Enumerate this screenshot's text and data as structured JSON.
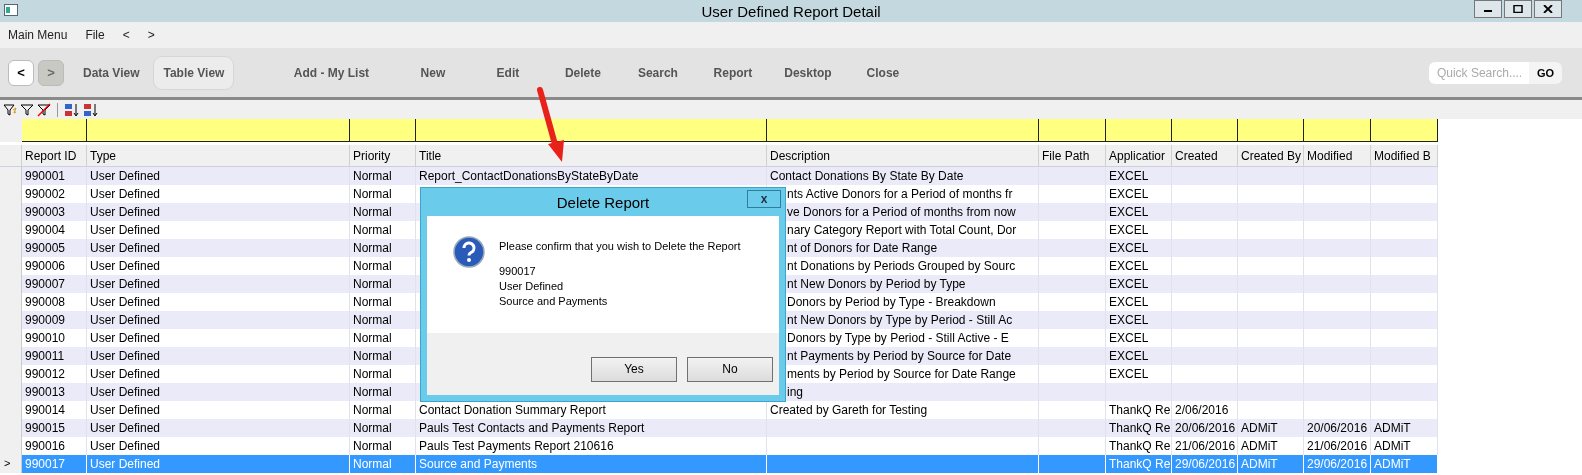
{
  "window": {
    "title": "User Defined Report Detail"
  },
  "menu": [
    "Main Menu",
    "File",
    "<",
    ">"
  ],
  "toolbar": {
    "nav": [
      {
        "label": "<",
        "disabled": false
      },
      {
        "label": ">",
        "disabled": true
      }
    ],
    "views": [
      {
        "label": "Data View",
        "selected": false
      },
      {
        "label": "Table View",
        "selected": true
      }
    ],
    "actions": [
      "Add - My List",
      "New",
      "Edit",
      "Delete",
      "Search",
      "Report",
      "Desktop",
      "Close"
    ],
    "search": {
      "placeholder": "Quick Search....",
      "button": "GO"
    }
  },
  "table": {
    "columns": [
      "Report ID",
      "Type",
      "Priority",
      "Title",
      "Description",
      "File Path",
      "Applicatior",
      "Created",
      "Created By",
      "Modified",
      "Modified B"
    ],
    "rows": [
      {
        "id": "990001",
        "type": "User Defined",
        "priority": "Normal",
        "title": "Report_ContactDonationsByStateByDate",
        "description": "Contact Donations By State By Date",
        "application": "EXCEL",
        "covered": false,
        "selected": false
      },
      {
        "id": "990002",
        "type": "User Defined",
        "priority": "Normal",
        "description": "nts Active Donors for a Period of months fr",
        "application": "EXCEL",
        "covered": true,
        "selected": false
      },
      {
        "id": "990003",
        "type": "User Defined",
        "priority": "Normal",
        "description": "ve Donors for a Period of months from now",
        "application": "EXCEL",
        "covered": true,
        "selected": false
      },
      {
        "id": "990004",
        "type": "User Defined",
        "priority": "Normal",
        "description": "nary Category Report with Total Count, Dor",
        "application": "EXCEL",
        "covered": true,
        "selected": false
      },
      {
        "id": "990005",
        "type": "User Defined",
        "priority": "Normal",
        "description": "nt of Donors for Date Range",
        "application": "EXCEL",
        "covered": true,
        "selected": false
      },
      {
        "id": "990006",
        "type": "User Defined",
        "priority": "Normal",
        "description": "nt Donations by Periods Grouped by Sourc",
        "application": "EXCEL",
        "covered": true,
        "selected": false
      },
      {
        "id": "990007",
        "type": "User Defined",
        "priority": "Normal",
        "description": "nt New Donors by Period by Type",
        "application": "EXCEL",
        "covered": true,
        "selected": false
      },
      {
        "id": "990008",
        "type": "User Defined",
        "priority": "Normal",
        "description": "Donors by Period by Type - Breakdown",
        "application": "EXCEL",
        "covered": true,
        "selected": false
      },
      {
        "id": "990009",
        "type": "User Defined",
        "priority": "Normal",
        "description": "nt New Donors by Type by Period - Still Ac",
        "application": "EXCEL",
        "covered": true,
        "selected": false
      },
      {
        "id": "990010",
        "type": "User Defined",
        "priority": "Normal",
        "description": "Donors by Type by Period - Still Active - E",
        "application": "EXCEL",
        "covered": true,
        "selected": false
      },
      {
        "id": "990011",
        "type": "User Defined",
        "priority": "Normal",
        "description": "nt Payments by Period by Source for Date",
        "application": "EXCEL",
        "covered": true,
        "selected": false
      },
      {
        "id": "990012",
        "type": "User Defined",
        "priority": "Normal",
        "description": "ments by Period by Source for Date Range",
        "application": "EXCEL",
        "covered": true,
        "selected": false
      },
      {
        "id": "990013",
        "type": "User Defined",
        "priority": "Normal",
        "description": "ing",
        "covered": true,
        "selected": false
      },
      {
        "id": "990014",
        "type": "User Defined",
        "priority": "Normal",
        "title": "Contact Donation Summary Report",
        "description": "Created by Gareth for Testing",
        "application": "ThankQ Re",
        "created": "2/06/2016",
        "covered": false,
        "selected": false
      },
      {
        "id": "990015",
        "type": "User Defined",
        "priority": "Normal",
        "title": "Pauls Test Contacts and Payments Report",
        "application": "ThankQ Re",
        "created": "20/06/2016",
        "created_by": "ADMiT",
        "modified": "20/06/2016",
        "modified_by": "ADMiT",
        "covered": false,
        "selected": false
      },
      {
        "id": "990016",
        "type": "User Defined",
        "priority": "Normal",
        "title": "Pauls Test Payments Report 210616",
        "application": "ThankQ Re",
        "created": "21/06/2016",
        "created_by": "ADMiT",
        "modified": "21/06/2016",
        "modified_by": "ADMiT",
        "covered": false,
        "selected": false
      },
      {
        "id": "990017",
        "type": "User Defined",
        "priority": "Normal",
        "title": "Source and Payments",
        "application": "ThankQ Re",
        "created": "29/06/2016",
        "created_by": "ADMiT",
        "modified": "29/06/2016",
        "modified_by": "ADMiT",
        "covered": false,
        "selected": true,
        "marker": ">"
      }
    ]
  },
  "dialog": {
    "title": "Delete Report",
    "close": "x",
    "message": "Please confirm that you wish to Delete the Report",
    "details": [
      "990017",
      "User Defined",
      "Source and Payments"
    ],
    "buttons": [
      "Yes",
      "No"
    ]
  }
}
